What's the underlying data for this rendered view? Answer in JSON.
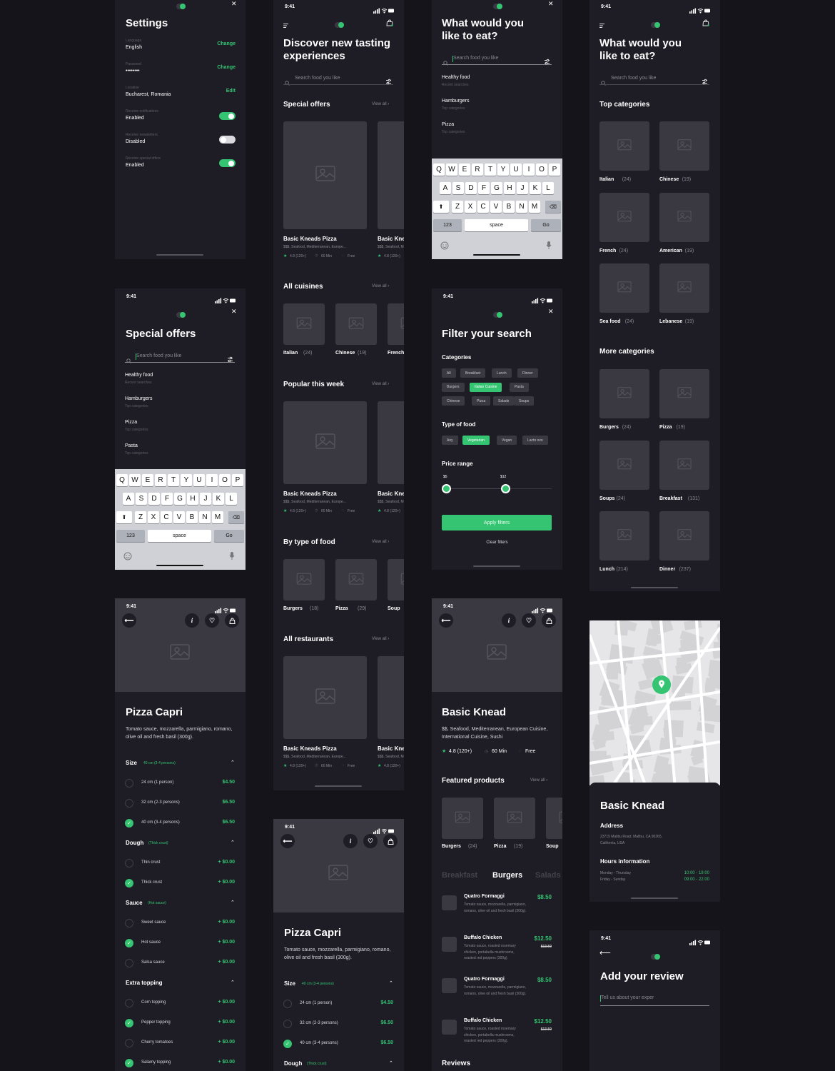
{
  "status_time": "9:41",
  "colors": {
    "background": "#15141b",
    "screen": "#1e1d25",
    "placeholder": "#3a3941",
    "accent": "#34c472"
  },
  "icons": [
    "menu-icon",
    "logo-icon",
    "bag-icon",
    "search-icon",
    "filter-icon",
    "close-icon",
    "image-placeholder-icon",
    "star-icon",
    "clock-icon",
    "back-icon",
    "info-icon",
    "heart-icon",
    "check-icon",
    "chevron-up-icon",
    "map-pin-icon",
    "emoji-icon",
    "microphone-icon",
    "shift-icon",
    "delete-icon"
  ],
  "settings": {
    "title": "Settings",
    "rows": [
      {
        "label": "Language",
        "value": "English",
        "action": "Change"
      },
      {
        "label": "Password",
        "value": "••••••••",
        "action": "Change"
      },
      {
        "label": "Location",
        "value": "Bucharest, Romania",
        "action": "Edit"
      }
    ],
    "toggles": [
      {
        "label": "Receive notifications",
        "value": "Enabled",
        "on": true
      },
      {
        "label": "Receive newsletters",
        "value": "Disabled",
        "on": false
      },
      {
        "label": "Receive special offers",
        "value": "Enabled",
        "on": true
      }
    ]
  },
  "search_offers": {
    "title": "Special offers",
    "placeholder": "Search food you like",
    "suggestions": [
      {
        "name": "Healthy food",
        "sub": "Recent searches"
      },
      {
        "name": "Hamburgers",
        "sub": "Top categories"
      },
      {
        "name": "Pizza",
        "sub": "Top categories"
      },
      {
        "name": "Pasta",
        "sub": "Top categories"
      }
    ]
  },
  "search_eat": {
    "title": "What would you like to eat?",
    "placeholder": "Search food you like",
    "suggestions": [
      {
        "name": "Healthy food",
        "sub": "Recent searches"
      },
      {
        "name": "Hamburgers",
        "sub": "Top categories"
      },
      {
        "name": "Pizza",
        "sub": "Top categories"
      }
    ]
  },
  "keyboard": {
    "rows": [
      [
        "Q",
        "W",
        "E",
        "R",
        "T",
        "Y",
        "U",
        "I",
        "O",
        "P"
      ],
      [
        "A",
        "S",
        "D",
        "F",
        "G",
        "H",
        "J",
        "K",
        "L"
      ],
      [
        "Z",
        "X",
        "C",
        "V",
        "B",
        "N",
        "M"
      ]
    ],
    "numbers": "123",
    "space": "space",
    "go": "Go"
  },
  "discover": {
    "title": "Discover new tasting experiences",
    "placeholder": "Search food you like",
    "view_all": "View all ›",
    "restaurant": {
      "name": "Basic Kneads Pizza",
      "meta": "$$$, Seafood, Mediterranean, Europe...",
      "rating": "4.8 (120+)",
      "time": "60 Min",
      "delivery": "Free"
    },
    "sections": [
      {
        "title": "Special offers",
        "kind": "big"
      },
      {
        "title": "All cuisines",
        "kind": "small",
        "items": [
          {
            "name": "Italian",
            "count": "(24)"
          },
          {
            "name": "Chinese",
            "count": "(19)"
          },
          {
            "name": "French",
            "count": ""
          }
        ]
      },
      {
        "title": "Popular this week",
        "kind": "big"
      },
      {
        "title": "By type of food",
        "kind": "small",
        "items": [
          {
            "name": "Burgers",
            "count": "(18)"
          },
          {
            "name": "Pizza",
            "count": "(29)"
          },
          {
            "name": "Soup",
            "count": ""
          }
        ]
      },
      {
        "title": "All restaurants",
        "kind": "big"
      }
    ]
  },
  "filter": {
    "title": "Filter your search",
    "categories_label": "Categories",
    "categories": [
      {
        "label": "All"
      },
      {
        "label": "Breakfast"
      },
      {
        "label": "Lunch"
      },
      {
        "label": "Dinner"
      },
      {
        "label": "Burgers"
      },
      {
        "label": "Italian Cuisine",
        "on": true
      },
      {
        "label": "Pasta"
      },
      {
        "label": "Chinese"
      },
      {
        "label": "Pizza"
      },
      {
        "label": "Salads"
      },
      {
        "label": "Soups"
      }
    ],
    "type_label": "Type of food",
    "types": [
      {
        "label": "Any"
      },
      {
        "label": "Vegetarian",
        "on": true
      },
      {
        "label": "Vegan"
      },
      {
        "label": "Lacto ovo"
      }
    ],
    "price_label": "Price range",
    "price_min": "$5",
    "price_max": "$12",
    "price_min_value": 5,
    "price_max_value": 12,
    "apply": "Apply filters",
    "clear": "Clear filters"
  },
  "categories_screen": {
    "title": "What would you like to eat?",
    "placeholder": "Search food you like",
    "top_label": "Top categories",
    "top": [
      {
        "name": "Italian",
        "count": "(24)"
      },
      {
        "name": "Chinese",
        "count": "(19)"
      },
      {
        "name": "French",
        "count": "(24)"
      },
      {
        "name": "American",
        "count": "(19)"
      },
      {
        "name": "Sea food",
        "count": "(24)"
      },
      {
        "name": "Lebanese",
        "count": "(19)"
      }
    ],
    "more_label": "More categories",
    "more": [
      {
        "name": "Burgers",
        "count": "(24)"
      },
      {
        "name": "Pizza",
        "count": "(19)"
      },
      {
        "name": "Soups",
        "count": "(24)"
      },
      {
        "name": "Breakfast",
        "count": "(131)"
      },
      {
        "name": "Lunch",
        "count": "(214)"
      },
      {
        "name": "Dinner",
        "count": "(237)"
      }
    ]
  },
  "pizza_capri": {
    "title": "Pizza Capri",
    "description": "Tomato sauce, mozzarella, parmigiano, romano, olive oil and fresh basil (300g).",
    "sections": [
      {
        "title": "Size",
        "selected": "40 cm (3-4 persons)",
        "options": [
          {
            "label": "24 cm (1 person)",
            "price": "$4.50",
            "checked": false
          },
          {
            "label": "32 cm (2-3 persons)",
            "price": "$6.50",
            "checked": false
          },
          {
            "label": "40 cm (3-4 persons)",
            "price": "$6.50",
            "checked": true
          }
        ]
      },
      {
        "title": "Dough",
        "selected": "(Thick crust)",
        "options": [
          {
            "label": "Thin crust",
            "price": "+ $0.00",
            "checked": false
          },
          {
            "label": "Thick crust",
            "price": "+ $0.00",
            "checked": true
          }
        ]
      },
      {
        "title": "Sauce",
        "selected": "(Hot sauce)",
        "options": [
          {
            "label": "Sweet sauce",
            "price": "+ $0.00",
            "checked": false
          },
          {
            "label": "Hot sauce",
            "price": "+ $0.00",
            "checked": true
          },
          {
            "label": "Salsa sauce",
            "price": "+ $0.00",
            "checked": false
          }
        ]
      },
      {
        "title": "Extra topping",
        "selected": "",
        "options": [
          {
            "label": "Corn topping",
            "price": "+ $0.00",
            "checked": false
          },
          {
            "label": "Pepper topping",
            "price": "+ $0.00",
            "checked": true
          },
          {
            "label": "Cherry tomatoes",
            "price": "+ $0.00",
            "checked": false
          },
          {
            "label": "Salamy topping",
            "price": "+ $0.00",
            "checked": true
          }
        ]
      }
    ]
  },
  "basic_knead": {
    "title": "Basic Knead",
    "description": "$$, Seafood, Mediterranean, European Cuisine, International Cuisine, Sushi",
    "rating": "4.8 (120+)",
    "time": "60 Min",
    "delivery": "Free",
    "featured_label": "Featured products",
    "view_all": "View all ›",
    "featured": [
      {
        "name": "Burgers",
        "count": "(24)"
      },
      {
        "name": "Pizza",
        "count": "(19)"
      },
      {
        "name": "Soup",
        "count": ""
      }
    ],
    "tabs": [
      {
        "label": "Breakfast",
        "active": false
      },
      {
        "label": "Burgers",
        "active": true
      },
      {
        "label": "Salads",
        "active": false
      }
    ],
    "products": [
      {
        "name": "Quatro Formaggi",
        "description": "Tomato sauce, mozzarella, parmigiano, romano, olive oil and fresh basil (300g).",
        "price": "$8.50",
        "old_price": ""
      },
      {
        "name": "Buffalo Chicken",
        "description": "Tomato sauce, roasted rosemary chicken, portabella mushrooms, roasted red peppers (300g).",
        "price": "$12.50",
        "old_price": "$13.50"
      },
      {
        "name": "Quatro Formaggi",
        "description": "Tomato sauce, mozzarella, parmigiano, romano, olive oil and fresh basil (300g).",
        "price": "$8.50",
        "old_price": ""
      },
      {
        "name": "Buffalo Chicken",
        "description": "Tomato sauce, roasted rosemary chicken, portabella mushrooms, roasted red peppers (300g).",
        "price": "$12.50",
        "old_price": "$13.50"
      }
    ],
    "reviews_label": "Reviews"
  },
  "restaurant_info": {
    "title": "Basic Knead",
    "address_label": "Address",
    "address": "23715 Malibu Road, Malibu, CA 90265, California, USA",
    "hours_label": "Hours information",
    "hours": [
      {
        "days": "Monday - Thursday",
        "time": "10:00 - 19:00"
      },
      {
        "days": "Friday - Sunday",
        "time": "09:00 - 22:00"
      }
    ]
  },
  "review": {
    "title": "Add your review",
    "placeholder": "Tell us about your exper"
  }
}
